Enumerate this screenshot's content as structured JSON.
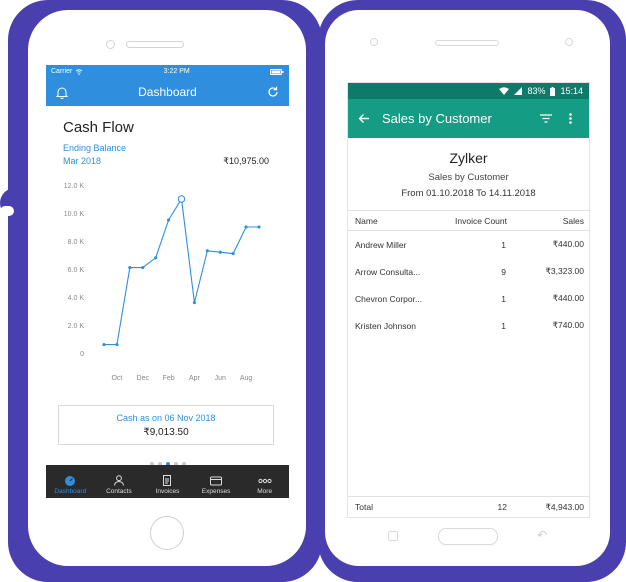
{
  "ios": {
    "status": {
      "carrier": "Carrier",
      "time": "3:22 PM"
    },
    "nav": {
      "title": "Dashboard"
    },
    "cashflow": {
      "title": "Cash Flow",
      "subtitle": "Ending Balance",
      "period": "Mar 2018",
      "amount": "₹10,975.00"
    },
    "cash_box": {
      "label": "Cash as on 06 Nov 2018",
      "value": "₹9,013.50"
    },
    "page_dots": {
      "count": 5,
      "active": 2
    },
    "tabs": [
      {
        "label": "Dashboard",
        "icon": "dashboard-icon"
      },
      {
        "label": "Contacts",
        "icon": "contacts-icon"
      },
      {
        "label": "Invoices",
        "icon": "invoices-icon"
      },
      {
        "label": "Expenses",
        "icon": "expenses-icon"
      },
      {
        "label": "More",
        "icon": "more-icon"
      }
    ],
    "colors": {
      "accent": "#2f8fde",
      "tabbar": "#2a2a2a"
    }
  },
  "chart_data": {
    "type": "line",
    "title": "",
    "x": [
      "",
      "Oct",
      "",
      "Dec",
      "",
      "Feb",
      "",
      "Apr",
      "",
      "Jun",
      "",
      "Aug",
      ""
    ],
    "y_ticks": [
      "12.0 K",
      "10.0 K",
      "8.0 K",
      "6.0 K",
      "4.0 K",
      "2.0 K",
      "0"
    ],
    "ylim": [
      0,
      12
    ],
    "series": [
      {
        "values": [
          0.6,
          0.6,
          6.1,
          6.1,
          6.8,
          9.5,
          11.0,
          3.6,
          7.3,
          7.2,
          7.1,
          9.0,
          9.0
        ],
        "highlight_index": 6
      }
    ],
    "grid": false
  },
  "android": {
    "status": {
      "battery": "83%",
      "time": "15:14"
    },
    "toolbar": {
      "title": "Sales by Customer"
    },
    "report": {
      "org": "Zylker",
      "name": "Sales by Customer",
      "range": "From 01.10.2018 To 14.11.2018"
    },
    "table": {
      "headers": [
        "Name",
        "Invoice Count",
        "Sales"
      ],
      "rows": [
        [
          "Andrew Miller",
          "1",
          "₹440.00"
        ],
        [
          "Arrow Consulta...",
          "9",
          "₹3,323.00"
        ],
        [
          "Chevron Corpor...",
          "1",
          "₹440.00"
        ],
        [
          "Kristen Johnson",
          "1",
          "₹740.00"
        ]
      ],
      "total": [
        "Total",
        "12",
        "₹4,943.00"
      ]
    },
    "colors": {
      "statusbar": "#0e7a6a",
      "toolbar": "#149c84"
    }
  },
  "backdrop": {
    "color": "#4a3fae"
  }
}
